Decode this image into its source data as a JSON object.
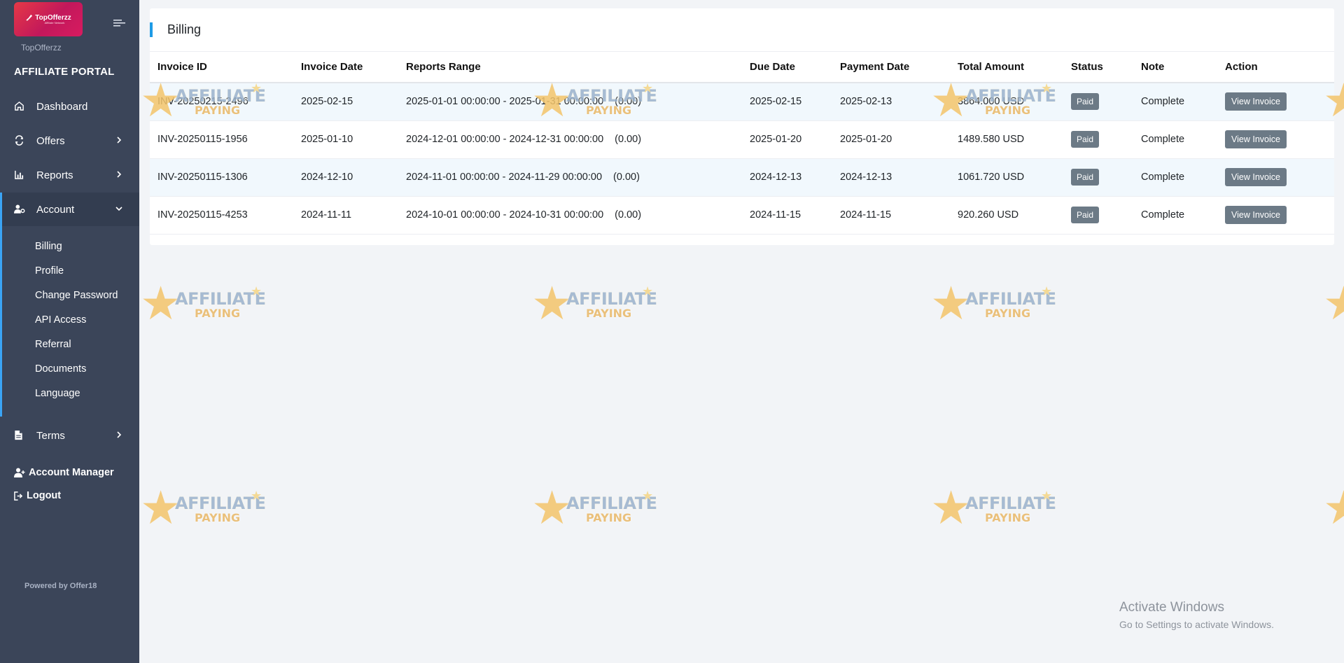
{
  "sidebar": {
    "brand_logo_text": "TopOfferzz",
    "brand_logo_sub": "Affiliate Network",
    "brand_name": "TopOfferzz",
    "portal_title": "AFFILIATE PORTAL",
    "nav": {
      "dashboard": "Dashboard",
      "offers": "Offers",
      "reports": "Reports",
      "account": "Account",
      "terms": "Terms"
    },
    "account_submenu": [
      "Billing",
      "Profile",
      "Change Password",
      "API Access",
      "Referral",
      "Documents",
      "Language"
    ],
    "account_manager": "Account Manager",
    "logout": "Logout",
    "powered_by": "Powered by Offer18"
  },
  "billing": {
    "title": "Billing",
    "columns": [
      "Invoice ID",
      "Invoice Date",
      "Reports Range",
      "Due Date",
      "Payment Date",
      "Total Amount",
      "Status",
      "Note",
      "Action"
    ],
    "rows": [
      {
        "invoice_id": "INV-20250215-2496",
        "invoice_date": "2025-02-15",
        "range": "2025-01-01 00:00:00 - 2025-01-31 00:00:00",
        "range_extra": "(0.00)",
        "due_date": "2025-02-15",
        "payment_date": "2025-02-13",
        "total": "3864.000 USD",
        "status": "Paid",
        "note": "Complete",
        "action": "View Invoice"
      },
      {
        "invoice_id": "INV-20250115-1956",
        "invoice_date": "2025-01-10",
        "range": "2024-12-01 00:00:00 - 2024-12-31 00:00:00",
        "range_extra": "(0.00)",
        "due_date": "2025-01-20",
        "payment_date": "2025-01-20",
        "total": "1489.580 USD",
        "status": "Paid",
        "note": "Complete",
        "action": "View Invoice"
      },
      {
        "invoice_id": "INV-20250115-1306",
        "invoice_date": "2024-12-10",
        "range": "2024-11-01 00:00:00 - 2024-11-29 00:00:00",
        "range_extra": "(0.00)",
        "due_date": "2024-12-13",
        "payment_date": "2024-12-13",
        "total": "1061.720 USD",
        "status": "Paid",
        "note": "Complete",
        "action": "View Invoice"
      },
      {
        "invoice_id": "INV-20250115-4253",
        "invoice_date": "2024-11-11",
        "range": "2024-10-01 00:00:00 - 2024-10-31 00:00:00",
        "range_extra": "(0.00)",
        "due_date": "2024-11-15",
        "payment_date": "2024-11-15",
        "total": "920.260 USD",
        "status": "Paid",
        "note": "Complete",
        "action": "View Invoice"
      }
    ]
  },
  "watermark": {
    "line1": "AFFILIATE",
    "line2": "PAYING"
  },
  "os_notice": {
    "title": "Activate Windows",
    "subtitle": "Go to Settings to activate Windows."
  },
  "colors": {
    "sidebar_bg": "#3b4559",
    "accent": "#1e9be6",
    "badge": "#6c7a86"
  }
}
